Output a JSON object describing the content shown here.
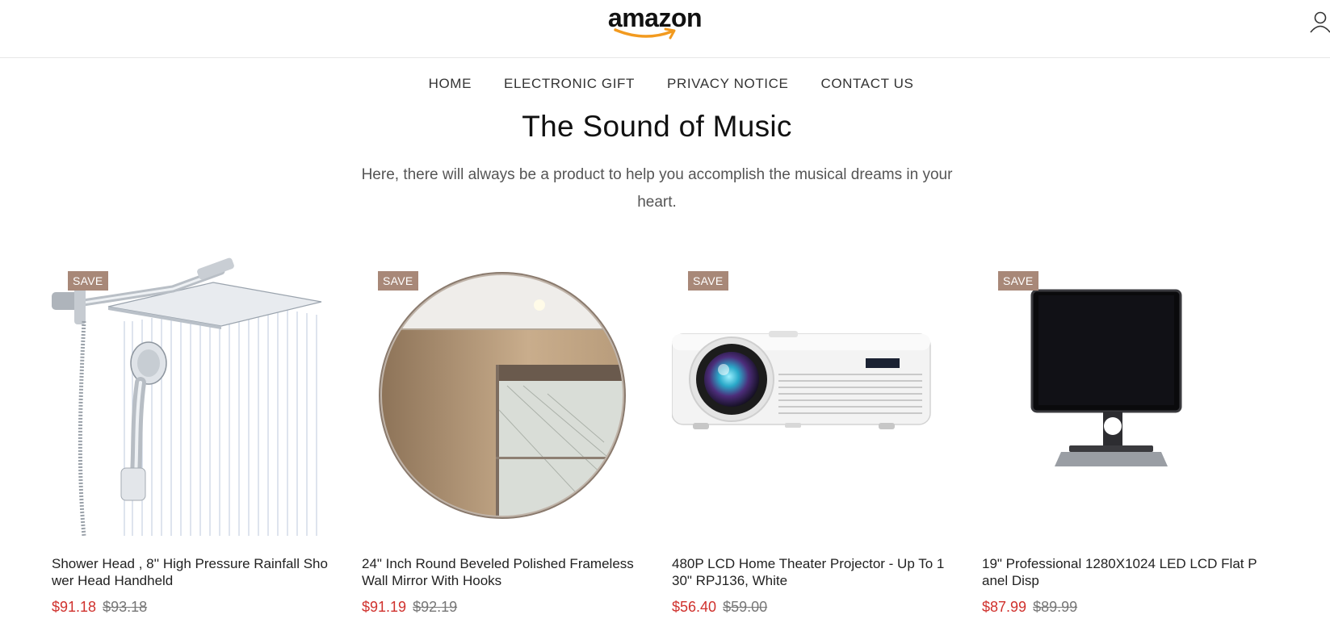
{
  "header": {
    "logo_text": "amazon",
    "account_icon": "user-icon"
  },
  "nav": {
    "items": [
      {
        "label": "HOME"
      },
      {
        "label": "ELECTRONIC GIFT"
      },
      {
        "label": "PRIVACY NOTICE"
      },
      {
        "label": "CONTACT US"
      }
    ]
  },
  "section": {
    "title": "The Sound of Music",
    "subtitle": "Here, there will always be a product to help you accomplish the musical dreams in your heart."
  },
  "products": [
    {
      "badge": "SAVE",
      "name": "Shower Head , 8'' High Pressure Rainfall Shower Head Handheld",
      "price": "$91.18",
      "old_price": "$93.18",
      "image": "shower-head-image"
    },
    {
      "badge": "SAVE",
      "name": "24\" Inch Round Beveled Polished Frameless Wall Mirror With Hooks",
      "price": "$91.19",
      "old_price": "$92.19",
      "image": "round-mirror-image"
    },
    {
      "badge": "SAVE",
      "name": "480P LCD Home Theater Projector - Up To 130\" RPJ136, White",
      "price": "$56.40",
      "old_price": "$59.00",
      "image": "projector-image"
    },
    {
      "badge": "SAVE",
      "name": "19\" Professional 1280X1024 LED LCD Flat Panel Disp",
      "price": "$87.99",
      "old_price": "$89.99",
      "image": "monitor-image"
    }
  ],
  "colors": {
    "badge_bg": "#a88878",
    "price_red": "#d0312d",
    "logo_smile": "#f29a1f"
  }
}
